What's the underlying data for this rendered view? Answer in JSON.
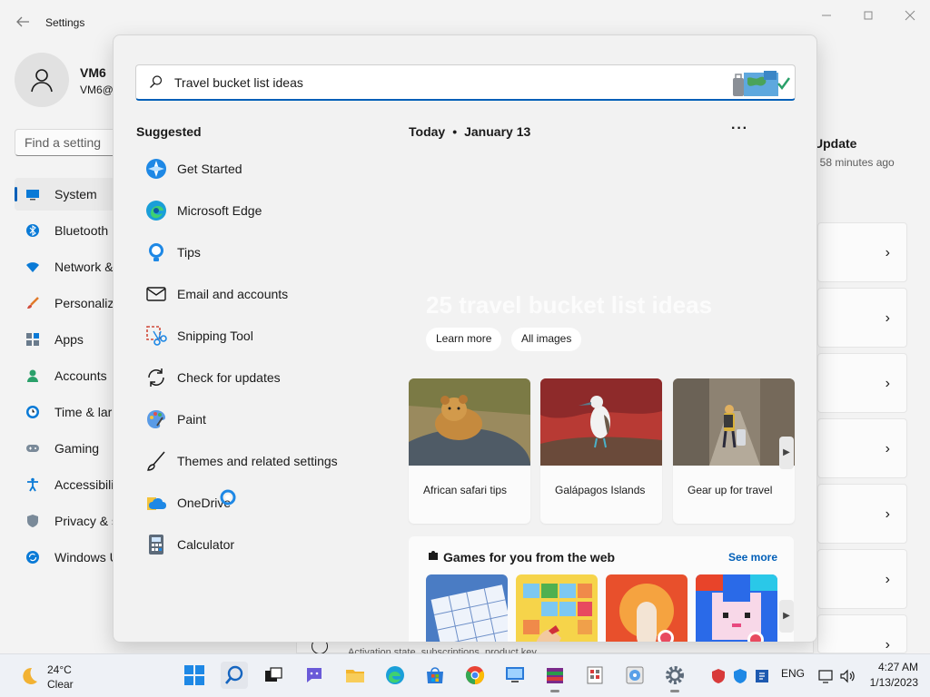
{
  "settings": {
    "title": "Settings",
    "user": {
      "name": "VM6",
      "email": "VM6@"
    },
    "find_placeholder": "Find a setting",
    "nav": [
      {
        "label": "System"
      },
      {
        "label": "Bluetooth"
      },
      {
        "label": "Network &"
      },
      {
        "label": "Personaliz"
      },
      {
        "label": "Apps"
      },
      {
        "label": "Accounts"
      },
      {
        "label": "Time & lar"
      },
      {
        "label": "Gaming"
      },
      {
        "label": "Accessibili"
      },
      {
        "label": "Privacy & s"
      },
      {
        "label": "Windows U"
      }
    ],
    "update_title": "Update",
    "update_sub": ": 58 minutes ago",
    "activation_text": "Activation state, subscriptions, product key"
  },
  "search": {
    "query": "Travel bucket list ideas",
    "suggested_title": "Suggested",
    "suggested": [
      {
        "label": "Get Started",
        "icon": "get-started-icon"
      },
      {
        "label": "Microsoft Edge",
        "icon": "edge-icon"
      },
      {
        "label": "Tips",
        "icon": "tips-icon"
      },
      {
        "label": "Email and accounts",
        "icon": "mail-icon"
      },
      {
        "label": "Snipping Tool",
        "icon": "snipping-tool-icon"
      },
      {
        "label": "Check for updates",
        "icon": "refresh-icon"
      },
      {
        "label": "Paint",
        "icon": "paint-icon"
      },
      {
        "label": "Themes and related settings",
        "icon": "brush-icon"
      },
      {
        "label": "OneDrive",
        "icon": "onedrive-icon"
      },
      {
        "label": "Calculator",
        "icon": "calculator-icon"
      }
    ],
    "today_label": "Today",
    "today_date": "January 13",
    "more": "···",
    "hero_text": "25 travel bucket list ideas",
    "learn_more": "Learn more",
    "all_images": "All images",
    "cards": [
      {
        "caption": "African safari tips"
      },
      {
        "caption": "Galápagos Islands"
      },
      {
        "caption": "Gear up for travel"
      }
    ],
    "games_title": "Games for you from the web",
    "see_more": "See more"
  },
  "taskbar": {
    "temp": "24°C",
    "condition": "Clear",
    "lang": "ENG",
    "time": "4:27 AM",
    "date": "1/13/2023"
  },
  "colors": {
    "accent": "#005fb8",
    "panel_bg": "#f2f2f2"
  }
}
